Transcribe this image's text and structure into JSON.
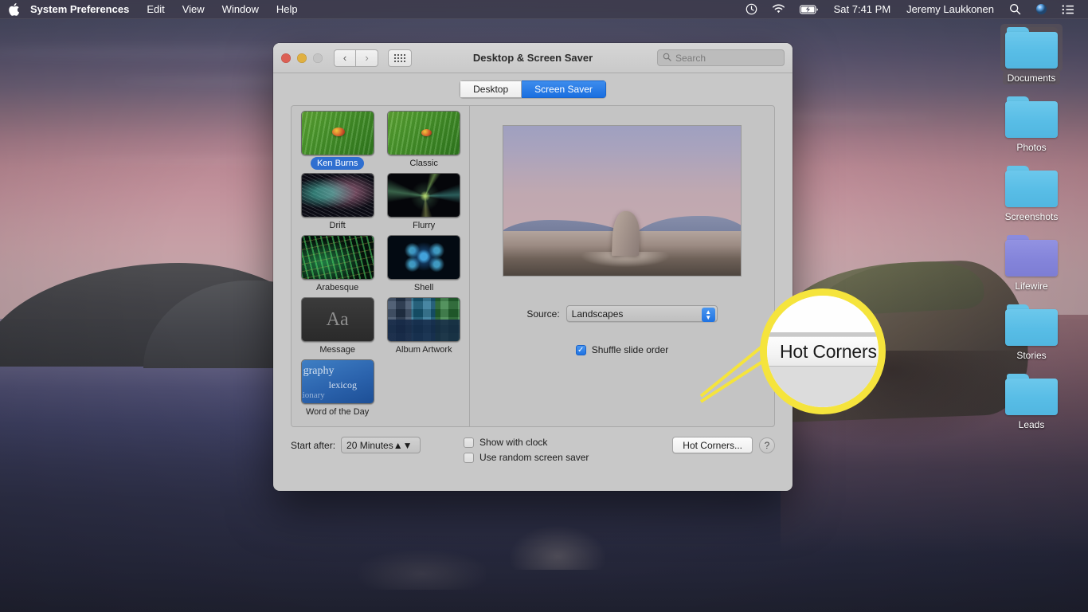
{
  "menubar": {
    "apple_icon": "apple-logo",
    "items": [
      "System Preferences",
      "Edit",
      "View",
      "Window",
      "Help"
    ],
    "status_icons": [
      "time-machine-icon",
      "wifi-icon",
      "battery-icon"
    ],
    "clock": "Sat 7:41 PM",
    "user": "Jeremy Laukkonen",
    "right_icons": [
      "search-icon",
      "siri-icon",
      "control-center-icon"
    ]
  },
  "desktop": {
    "icons": [
      {
        "label": "Documents",
        "color": "blue",
        "selected": true
      },
      {
        "label": "Photos",
        "color": "blue",
        "selected": false
      },
      {
        "label": "Screenshots",
        "color": "blue",
        "selected": false
      },
      {
        "label": "Lifewire",
        "color": "purple",
        "selected": false
      },
      {
        "label": "Stories",
        "color": "blue",
        "selected": false
      },
      {
        "label": "Leads",
        "color": "blue",
        "selected": false
      }
    ]
  },
  "window": {
    "title": "Desktop & Screen Saver",
    "traffic_lights": [
      "close",
      "minimize",
      "zoom-disabled"
    ],
    "nav_back": "‹",
    "nav_forward": "›",
    "grid_button": "show-all-icon",
    "search": {
      "placeholder": "Search",
      "value": ""
    },
    "tabs": [
      {
        "label": "Desktop",
        "active": false
      },
      {
        "label": "Screen Saver",
        "active": true
      }
    ]
  },
  "screensavers": [
    {
      "name": "Ken Burns",
      "selected": true,
      "art": "th-ken"
    },
    {
      "name": "Classic",
      "selected": false,
      "art": "th-classic"
    },
    {
      "name": "Drift",
      "selected": false,
      "art": "th-drift"
    },
    {
      "name": "Flurry",
      "selected": false,
      "art": "th-flurry"
    },
    {
      "name": "Arabesque",
      "selected": false,
      "art": "th-arab"
    },
    {
      "name": "Shell",
      "selected": false,
      "art": "th-shell"
    },
    {
      "name": "Message",
      "selected": false,
      "art": "th-msg"
    },
    {
      "name": "Album Artwork",
      "selected": false,
      "art": "th-album"
    },
    {
      "name": "Word of the Day",
      "selected": false,
      "art": "th-word"
    }
  ],
  "thumb_text": {
    "message_glyph": "Aa",
    "word_lines": [
      "graphy",
      "lexicog",
      "tionary"
    ]
  },
  "options": {
    "source_label": "Source:",
    "source_value": "Landscapes",
    "shuffle_label": "Shuffle slide order",
    "shuffle_checked": true
  },
  "footer": {
    "start_after_label": "Start after:",
    "start_after_value": "20 Minutes",
    "show_clock_label": "Show with clock",
    "show_clock_checked": false,
    "random_label": "Use random screen saver",
    "random_checked": false,
    "hot_corners_label": "Hot Corners...",
    "help_label": "?"
  },
  "callout": {
    "magnified_text": "Hot Corners...",
    "highlight_color": "#f5e43c"
  }
}
